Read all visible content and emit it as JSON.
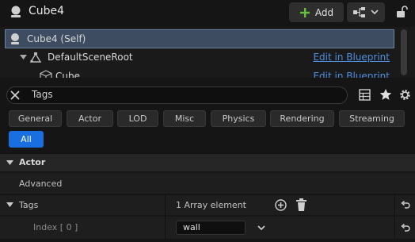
{
  "header": {
    "title": "Cube4",
    "add_label": "Add"
  },
  "tree": {
    "items": [
      {
        "label": "Cube4 (Self)",
        "link": ""
      },
      {
        "label": "DefaultSceneRoot",
        "link": "Edit in Blueprint"
      },
      {
        "label": "Cube",
        "link": "Edit in Blueprint"
      }
    ]
  },
  "search": {
    "value": "Tags"
  },
  "filter_tabs": [
    "General",
    "Actor",
    "LOD",
    "Misc",
    "Physics",
    "Rendering",
    "Streaming"
  ],
  "active_tab": "All",
  "details": {
    "section": "Actor",
    "advanced": "Advanced",
    "tags_label": "Tags",
    "array_count": "1 Array element",
    "index_label": "Index [ 0 ]",
    "index_value": "wall"
  },
  "colors": {
    "accent": "#1a6fe0",
    "link": "#4f8fe0",
    "add_icon": "#6abf3a",
    "selected_row": "#3d4c61"
  }
}
